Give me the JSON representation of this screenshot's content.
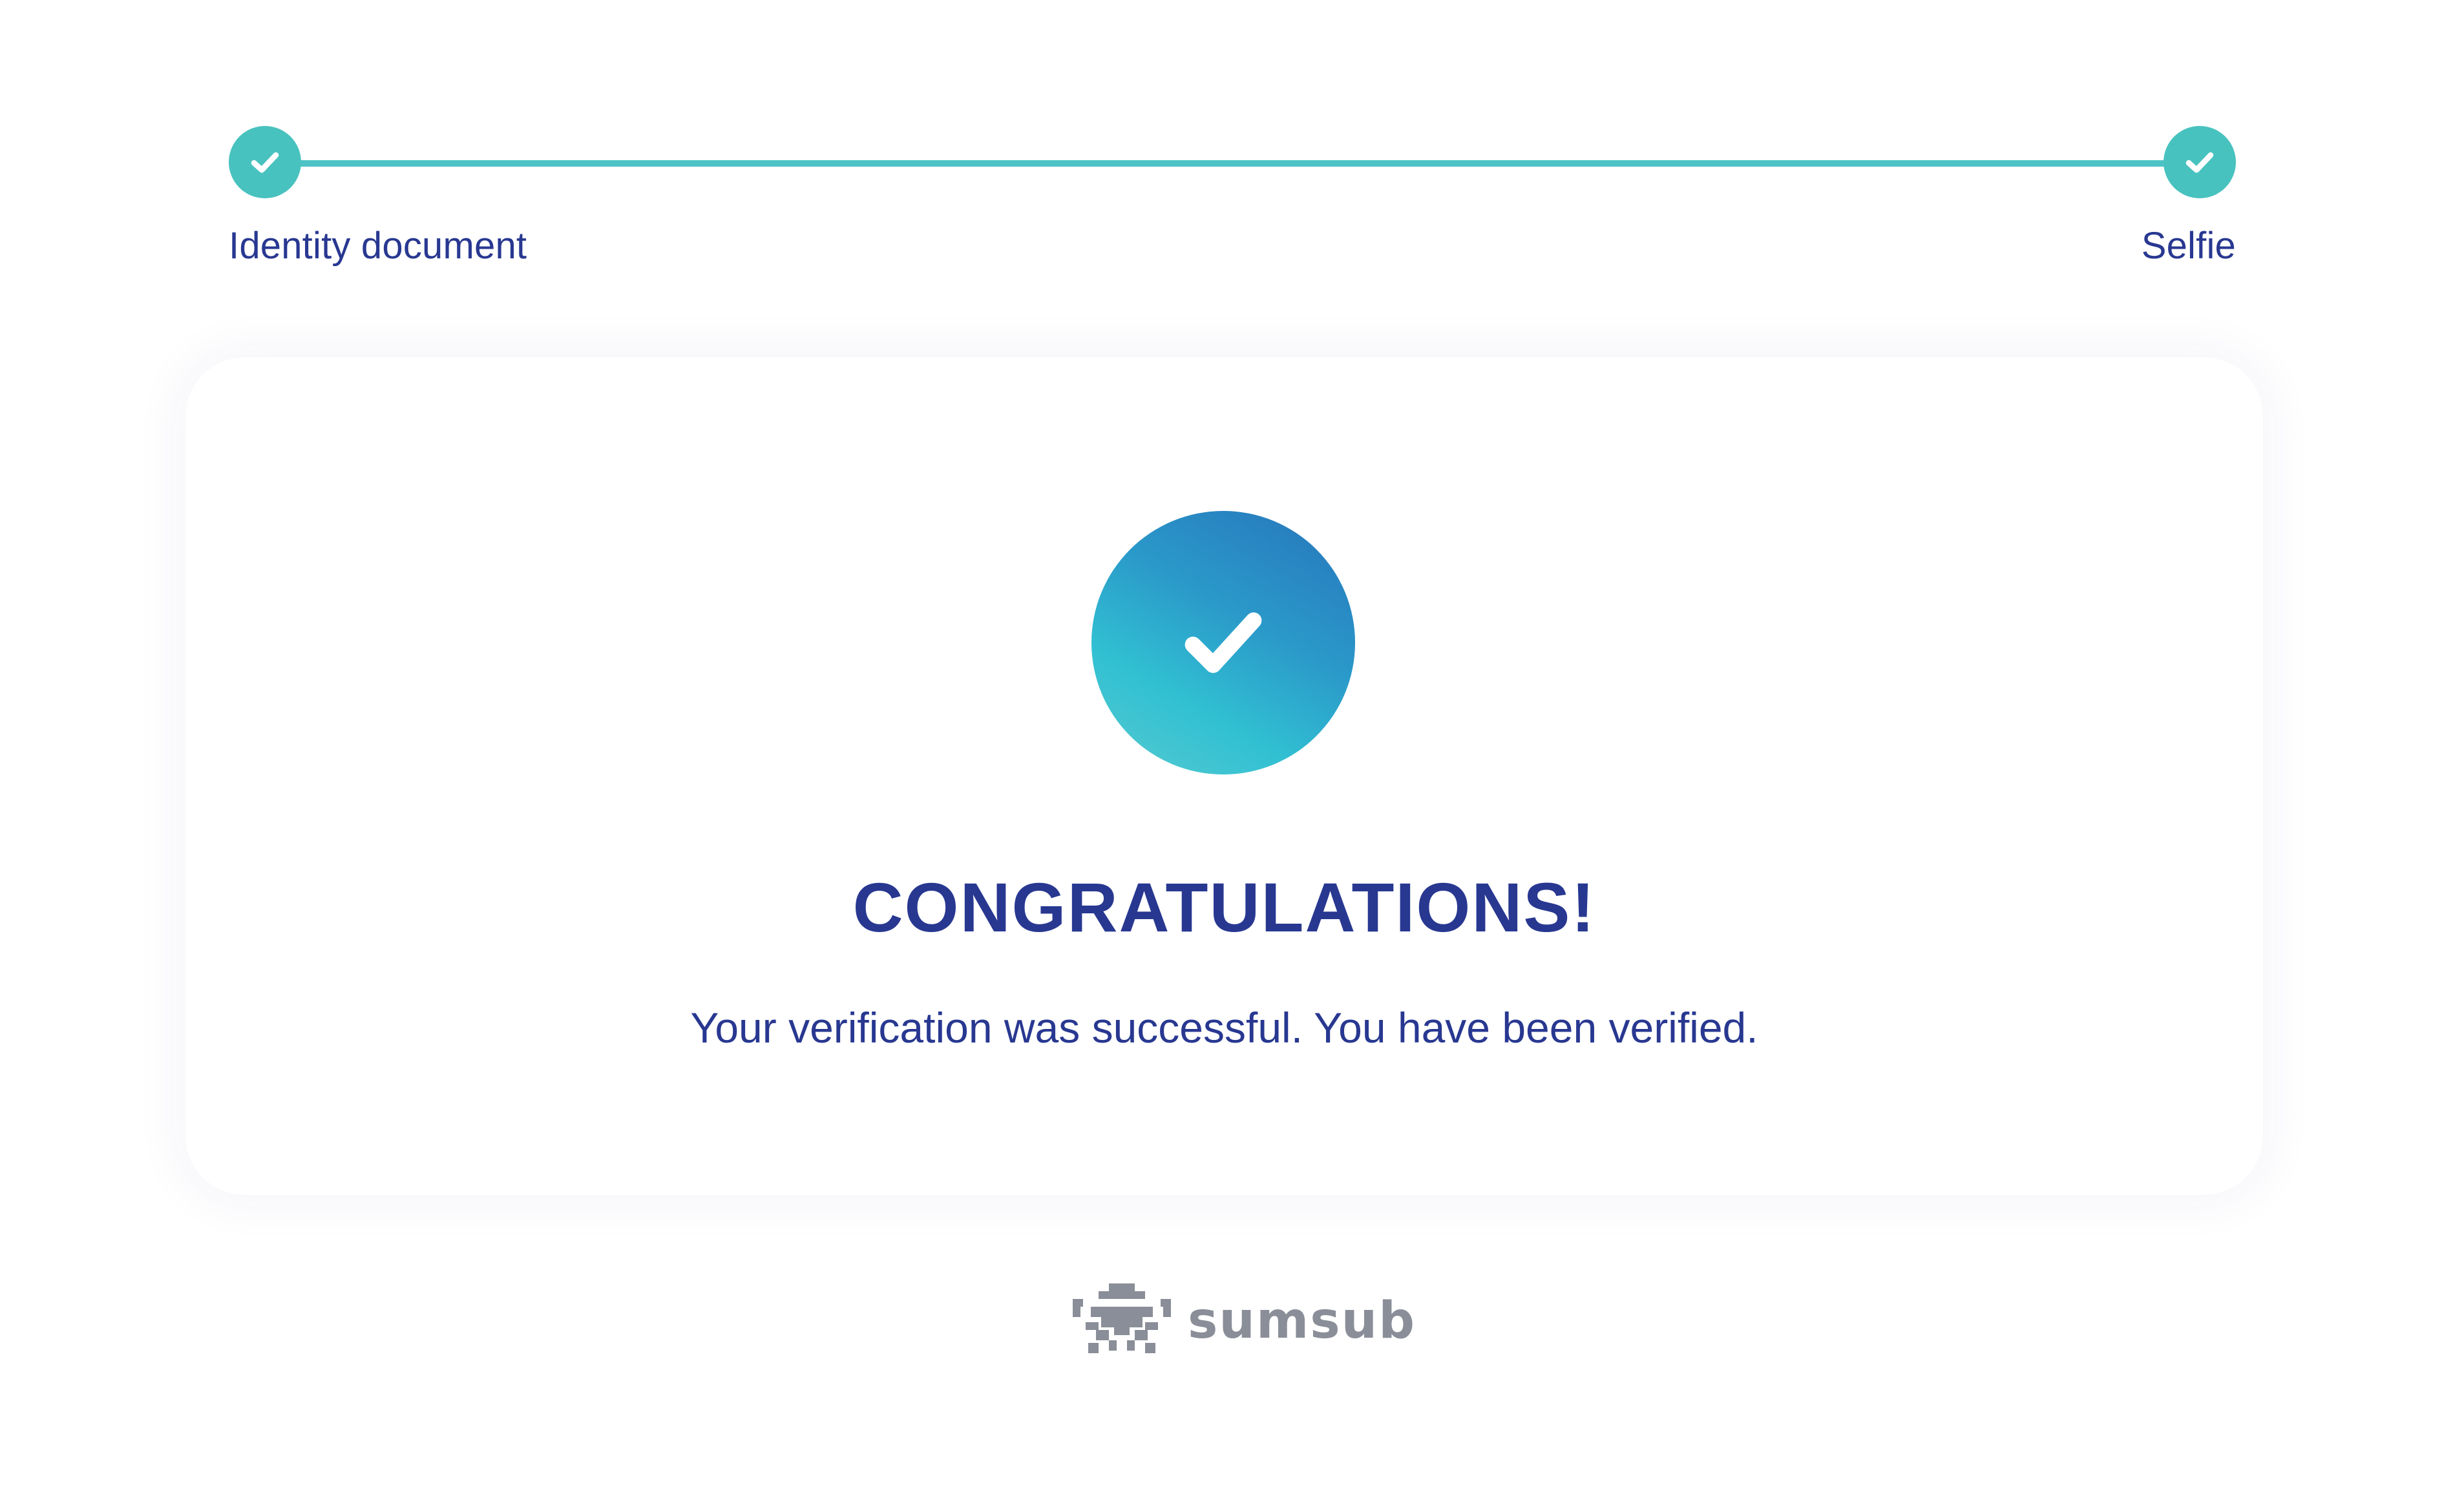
{
  "stepper": {
    "steps": [
      {
        "label": "Identity document",
        "status": "completed",
        "icon": "check-icon"
      },
      {
        "label": "Selfie",
        "status": "completed",
        "icon": "check-icon"
      }
    ],
    "accent_color": "#48c2bf"
  },
  "result": {
    "icon": "check-circle-icon",
    "title": "CONGRATULATIONS!",
    "message": "Your verification was successful. You have been verified.",
    "text_color": "#283891"
  },
  "footer": {
    "brand_name": "sumsub",
    "brand_icon": "sumsub-logo-icon"
  }
}
